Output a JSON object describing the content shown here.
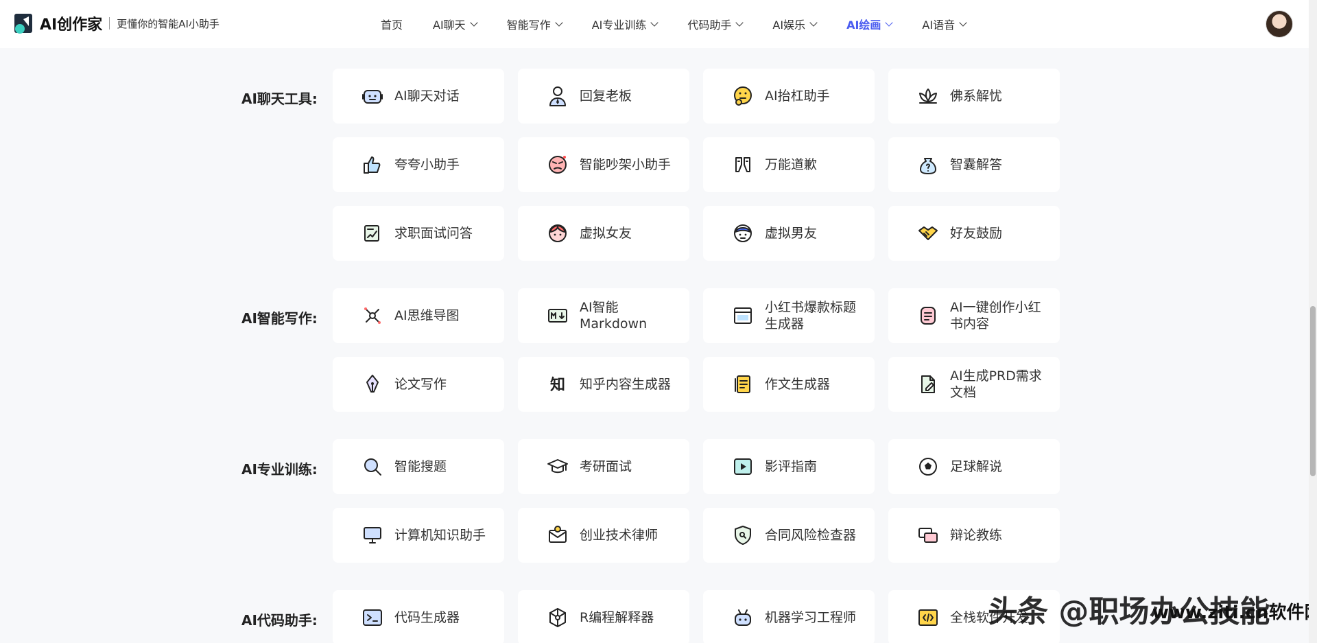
{
  "header": {
    "logo_text": "AI创作家",
    "slogan": "更懂你的智能AI小助手",
    "nav": [
      {
        "label": "首页",
        "has_menu": false
      },
      {
        "label": "AI聊天",
        "has_menu": true
      },
      {
        "label": "智能写作",
        "has_menu": true
      },
      {
        "label": "AI专业训练",
        "has_menu": true
      },
      {
        "label": "代码助手",
        "has_menu": true
      },
      {
        "label": "AI娱乐",
        "has_menu": true
      },
      {
        "label": "AI绘画",
        "has_menu": true,
        "active": true
      },
      {
        "label": "AI语音",
        "has_menu": true
      }
    ],
    "accent_color": "#4a5cf0"
  },
  "sections": [
    {
      "title": "AI聊天工具:",
      "items": [
        {
          "label": "AI聊天对话",
          "icon": "robot-icon"
        },
        {
          "label": "回复老板",
          "icon": "boss-icon"
        },
        {
          "label": "AI抬杠助手",
          "icon": "thinking-face-icon"
        },
        {
          "label": "佛系解忧",
          "icon": "lotus-icon"
        },
        {
          "label": "夸夸小助手",
          "icon": "thumbs-up-icon"
        },
        {
          "label": "智能吵架小助手",
          "icon": "angry-face-icon"
        },
        {
          "label": "万能道歉",
          "icon": "apology-icon"
        },
        {
          "label": "智囊解答",
          "icon": "question-bag-icon"
        },
        {
          "label": "求职面试问答",
          "icon": "resume-icon"
        },
        {
          "label": "虚拟女友",
          "icon": "girl-face-icon"
        },
        {
          "label": "虚拟男友",
          "icon": "boy-face-icon"
        },
        {
          "label": "好友鼓励",
          "icon": "handshake-icon"
        }
      ]
    },
    {
      "title": "AI智能写作:",
      "items": [
        {
          "label": "AI思维导图",
          "icon": "mindmap-icon"
        },
        {
          "label": "AI智能Markdown",
          "icon": "markdown-icon"
        },
        {
          "label": "小红书爆款标题生成器",
          "icon": "title-window-icon"
        },
        {
          "label": "AI一键创作小红书内容",
          "icon": "note-icon"
        },
        {
          "label": "论文写作",
          "icon": "pen-nib-icon"
        },
        {
          "label": "知乎内容生成器",
          "icon": "zhihu-icon"
        },
        {
          "label": "作文生成器",
          "icon": "essay-icon"
        },
        {
          "label": "AI生成PRD需求文档",
          "icon": "document-edit-icon"
        }
      ]
    },
    {
      "title": "AI专业训练:",
      "items": [
        {
          "label": "智能搜题",
          "icon": "search-icon"
        },
        {
          "label": "考研面试",
          "icon": "graduation-cap-icon"
        },
        {
          "label": "影评指南",
          "icon": "play-icon"
        },
        {
          "label": "足球解说",
          "icon": "football-icon"
        },
        {
          "label": "计算机知识助手",
          "icon": "computer-icon"
        },
        {
          "label": "创业技术律师",
          "icon": "envelope-icon"
        },
        {
          "label": "合同风险检查器",
          "icon": "shield-search-icon"
        },
        {
          "label": "辩论教练",
          "icon": "chat-bubbles-icon"
        }
      ]
    },
    {
      "title": "AI代码助手:",
      "items": [
        {
          "label": "代码生成器",
          "icon": "terminal-icon"
        },
        {
          "label": "R编程解释器",
          "icon": "network-icon"
        },
        {
          "label": "机器学习工程师",
          "icon": "bot-icon"
        },
        {
          "label": "全栈软件开发",
          "icon": "code-window-icon"
        }
      ]
    }
  ],
  "watermark": "头条 @职场办公技能",
  "watermark_sub": "www.ziti.cn软件网"
}
